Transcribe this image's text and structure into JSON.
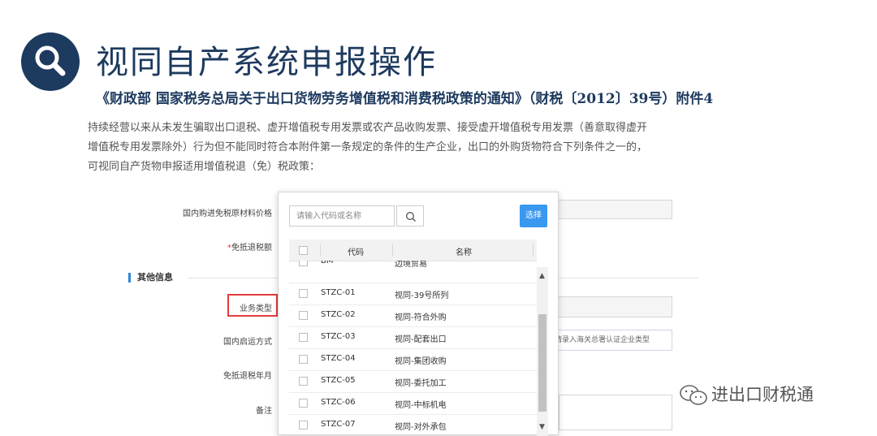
{
  "title": "视同自产系统申报操作",
  "subtitle": "《财政部 国家税务总局关于出口货物劳务增值税和消费税政策的通知》（财税〔2012〕39号）附件4",
  "paragraph": [
    "持续经营以来从未发生骗取出口退税、虚开增值税专用发票或农产品收购发票、接受虚开增值税专用发票（善意取得虚开",
    "增值税专用发票除外）行为但不能同时符合本附件第一条规定的条件的生产企业，出口的外购货物符合下列条件之一的，",
    "可视同自产货物申报适用增值税退（免）税政策："
  ],
  "form": {
    "domestic_material_price_label": "国内购进免税原材料价格",
    "exempt_amount_label": "免抵退税额",
    "required_mark": "*",
    "other_info_section": "其他信息",
    "business_type_label": "业务类型",
    "domestic_transport_label": "国内启运方式",
    "customs_hint": "请录入海关总署认证企业类型",
    "tax_year_label": "免抵退税年月",
    "remark_label": "备注"
  },
  "popup": {
    "search_placeholder": "请输入代码或名称",
    "select_label": "选择",
    "columns": {
      "code": "代码",
      "name": "名称"
    },
    "rows": [
      {
        "code": "BM",
        "name": "边境贸易"
      },
      {
        "code": "STZC-01",
        "name": "视同-39号所列"
      },
      {
        "code": "STZC-02",
        "name": "视同-符合外购"
      },
      {
        "code": "STZC-03",
        "name": "视同-配套出口"
      },
      {
        "code": "STZC-04",
        "name": "视同-集团收购"
      },
      {
        "code": "STZC-05",
        "name": "视同-委托加工"
      },
      {
        "code": "STZC-06",
        "name": "视同-中标机电"
      },
      {
        "code": "STZC-07",
        "name": "视同-对外承包"
      }
    ]
  },
  "watermark": "进出口财税通",
  "colors": {
    "title": "#1d3a5f",
    "accent_blue": "#3a98f0",
    "highlight_red": "#e23c3c"
  }
}
